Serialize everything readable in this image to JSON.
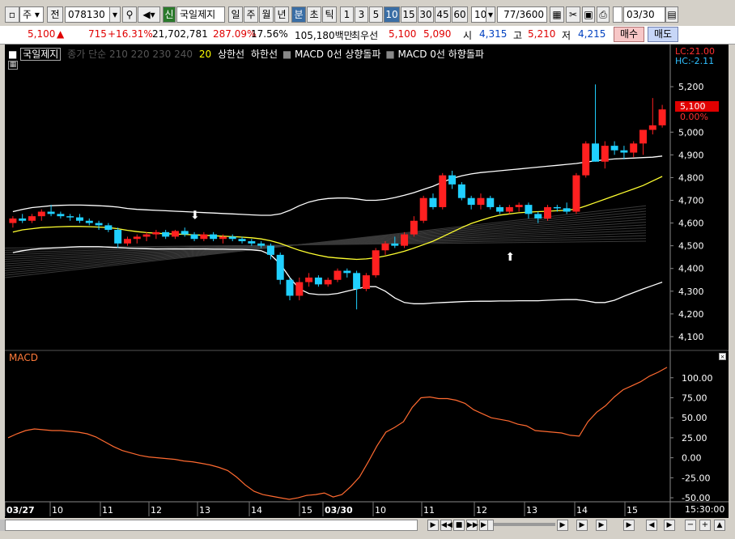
{
  "toolbar": {
    "period": "주",
    "all": "전",
    "code": "078130",
    "credit": "신",
    "stock_name": "국일제지",
    "periods": [
      "일",
      "주",
      "월",
      "년",
      "분",
      "초",
      "틱"
    ],
    "intervals": [
      "1",
      "3",
      "5",
      "10",
      "15",
      "30",
      "45",
      "60"
    ],
    "count": "10",
    "pages": "77",
    "pages_total": "/3600",
    "date": "03/30"
  },
  "info": {
    "price": "5,100",
    "arrow": "▲",
    "change": "715",
    "change_pct": "+16.31%",
    "volume": "21,702,781",
    "vol_pct": "287.09%",
    "turnover": "17.56%",
    "amount": "105,180백만",
    "bid_label": "최우선",
    "bid1": "5,100",
    "bid2": "5,090",
    "open_label": "시",
    "open": "4,315",
    "high_label": "고",
    "high": "5,210",
    "low_label": "저",
    "low": "4,215",
    "buy": "매수",
    "sell": "매도"
  },
  "legend": {
    "name": "국일제지",
    "ma": "종가 단순 210  220  230  240",
    "ma20": "20",
    "upper": "상한선",
    "lower": "하한선",
    "macd_up": "MACD 0선 상향돌파",
    "macd_down": "MACD 0선 하향돌파",
    "lc": "LC:21.00",
    "hc": "HC:-2.11"
  },
  "macd_label": "MACD",
  "price_box": "5,100",
  "price_pct": "0.00%",
  "time_label": "15:30:00",
  "chart_data": {
    "type": "candlestick",
    "price_axis": {
      "ticks": [
        "5,200",
        "5,000",
        "4,900",
        "4,800",
        "4,700",
        "4,600",
        "4,500",
        "4,400",
        "4,300",
        "4,200",
        "4,100"
      ],
      "ylim": [
        4050,
        5350
      ]
    },
    "macd_axis": {
      "ticks": [
        "100.00",
        "75.00",
        "50.00",
        "25.00",
        "0.00",
        "-25.00",
        "-50.00"
      ],
      "ylim": [
        -55,
        120
      ]
    },
    "x_ticks": [
      "03/27",
      "10",
      "11",
      "12",
      "13",
      "14",
      "15",
      "03/30",
      "10",
      "11",
      "12",
      "13",
      "14",
      "15"
    ],
    "candles": [
      [
        4600,
        4630,
        4580,
        4620
      ],
      [
        4620,
        4640,
        4600,
        4610
      ],
      [
        4610,
        4640,
        4600,
        4630
      ],
      [
        4630,
        4660,
        4610,
        4650
      ],
      [
        4650,
        4680,
        4630,
        4640
      ],
      [
        4640,
        4650,
        4620,
        4630
      ],
      [
        4630,
        4640,
        4610,
        4625
      ],
      [
        4625,
        4640,
        4600,
        4610
      ],
      [
        4610,
        4620,
        4590,
        4600
      ],
      [
        4600,
        4610,
        4570,
        4590
      ],
      [
        4590,
        4600,
        4560,
        4570
      ],
      [
        4570,
        4580,
        4490,
        4510
      ],
      [
        4510,
        4540,
        4500,
        4530
      ],
      [
        4530,
        4550,
        4510,
        4540
      ],
      [
        4540,
        4560,
        4520,
        4550
      ],
      [
        4550,
        4570,
        4530,
        4560
      ],
      [
        4560,
        4570,
        4530,
        4540
      ],
      [
        4540,
        4570,
        4530,
        4565
      ],
      [
        4565,
        4580,
        4540,
        4550
      ],
      [
        4550,
        4560,
        4520,
        4530
      ],
      [
        4530,
        4560,
        4520,
        4550
      ],
      [
        4550,
        4560,
        4520,
        4530
      ],
      [
        4530,
        4550,
        4510,
        4540
      ],
      [
        4540,
        4550,
        4520,
        4530
      ],
      [
        4530,
        4540,
        4510,
        4520
      ],
      [
        4520,
        4530,
        4500,
        4510
      ],
      [
        4510,
        4520,
        4490,
        4500
      ],
      [
        4500,
        4510,
        4440,
        4460
      ],
      [
        4460,
        4470,
        4330,
        4350
      ],
      [
        4350,
        4360,
        4260,
        4280
      ],
      [
        4280,
        4360,
        4260,
        4340
      ],
      [
        4340,
        4380,
        4320,
        4360
      ],
      [
        4360,
        4370,
        4320,
        4330
      ],
      [
        4330,
        4360,
        4320,
        4350
      ],
      [
        4350,
        4400,
        4340,
        4390
      ],
      [
        4390,
        4400,
        4360,
        4380
      ],
      [
        4380,
        4390,
        4220,
        4310
      ],
      [
        4310,
        4380,
        4300,
        4370
      ],
      [
        4370,
        4490,
        4360,
        4480
      ],
      [
        4480,
        4520,
        4460,
        4510
      ],
      [
        4510,
        4540,
        4490,
        4500
      ],
      [
        4500,
        4560,
        4490,
        4550
      ],
      [
        4550,
        4630,
        4540,
        4610
      ],
      [
        4610,
        4720,
        4600,
        4710
      ],
      [
        4710,
        4730,
        4660,
        4670
      ],
      [
        4670,
        4820,
        4660,
        4810
      ],
      [
        4810,
        4830,
        4750,
        4770
      ],
      [
        4770,
        4780,
        4700,
        4710
      ],
      [
        4710,
        4720,
        4660,
        4680
      ],
      [
        4680,
        4730,
        4660,
        4710
      ],
      [
        4710,
        4720,
        4660,
        4670
      ],
      [
        4670,
        4680,
        4640,
        4650
      ],
      [
        4650,
        4680,
        4640,
        4670
      ],
      [
        4670,
        4690,
        4650,
        4680
      ],
      [
        4680,
        4690,
        4620,
        4640
      ],
      [
        4640,
        4650,
        4600,
        4620
      ],
      [
        4620,
        4680,
        4610,
        4670
      ],
      [
        4670,
        4680,
        4650,
        4665
      ],
      [
        4665,
        4690,
        4640,
        4650
      ],
      [
        4650,
        4820,
        4640,
        4810
      ],
      [
        4810,
        4960,
        4800,
        4950
      ],
      [
        4950,
        5210,
        4870,
        4870
      ],
      [
        4870,
        4960,
        4840,
        4940
      ],
      [
        4940,
        4960,
        4900,
        4920
      ],
      [
        4920,
        4940,
        4880,
        4910
      ],
      [
        4910,
        4960,
        4890,
        4950
      ],
      [
        4950,
        5000,
        4900,
        5010
      ],
      [
        5010,
        5150,
        4990,
        5030
      ],
      [
        5030,
        5120,
        5020,
        5100
      ]
    ],
    "ma20": [
      4560,
      4570,
      4575,
      4580,
      4582,
      4584,
      4585,
      4585,
      4584,
      4582,
      4580,
      4575,
      4568,
      4562,
      4558,
      4555,
      4553,
      4552,
      4550,
      4548,
      4546,
      4544,
      4542,
      4540,
      4538,
      4535,
      4530,
      4522,
      4510,
      4495,
      4480,
      4468,
      4458,
      4450,
      4446,
      4443,
      4440,
      4442,
      4447,
      4455,
      4465,
      4476,
      4490,
      4505,
      4520,
      4540,
      4560,
      4580,
      4598,
      4612,
      4625,
      4635,
      4640,
      4645,
      4648,
      4650,
      4652,
      4654,
      4656,
      4662,
      4675,
      4690,
      4705,
      4720,
      4735,
      4750,
      4765,
      4785,
      4805
    ],
    "upper": [
      4650,
      4660,
      4668,
      4672,
      4676,
      4678,
      4679,
      4679,
      4678,
      4676,
      4674,
      4670,
      4664,
      4660,
      4658,
      4656,
      4654,
      4652,
      4650,
      4648,
      4646,
      4644,
      4642,
      4640,
      4638,
      4636,
      4634,
      4634,
      4640,
      4656,
      4676,
      4692,
      4702,
      4708,
      4710,
      4710,
      4706,
      4700,
      4700,
      4704,
      4712,
      4722,
      4734,
      4748,
      4762,
      4780,
      4796,
      4808,
      4816,
      4822,
      4826,
      4830,
      4834,
      4838,
      4842,
      4846,
      4850,
      4854,
      4858,
      4862,
      4868,
      4874,
      4878,
      4882,
      4884,
      4886,
      4888,
      4890,
      4895
    ],
    "lower": [
      4470,
      4478,
      4484,
      4488,
      4490,
      4492,
      4494,
      4496,
      4496,
      4496,
      4494,
      4492,
      4490,
      4488,
      4487,
      4486,
      4486,
      4486,
      4486,
      4486,
      4486,
      4485,
      4485,
      4484,
      4484,
      4482,
      4478,
      4460,
      4420,
      4360,
      4310,
      4290,
      4285,
      4285,
      4290,
      4300,
      4310,
      4320,
      4320,
      4300,
      4270,
      4250,
      4245,
      4245,
      4248,
      4250,
      4252,
      4254,
      4255,
      4256,
      4256,
      4257,
      4257,
      4258,
      4258,
      4258,
      4260,
      4262,
      4263,
      4263,
      4258,
      4250,
      4250,
      4260,
      4278,
      4294,
      4310,
      4325,
      4340
    ],
    "macd": [
      25,
      30,
      34,
      36,
      35,
      34,
      34,
      33,
      32,
      30,
      26,
      20,
      14,
      9,
      6,
      3,
      1,
      0,
      -1,
      -2,
      -4,
      -5,
      -7,
      -9,
      -12,
      -16,
      -24,
      -34,
      -42,
      -46,
      -48,
      -50,
      -52,
      -50,
      -47,
      -46,
      -44,
      -49,
      -46,
      -36,
      -24,
      -5,
      15,
      32,
      38,
      45,
      63,
      75,
      76,
      74,
      74,
      72,
      68,
      60,
      55,
      50,
      48,
      46,
      42,
      40,
      34,
      33,
      32,
      31,
      28,
      27,
      45,
      57,
      65,
      76,
      85,
      90,
      95,
      102,
      107,
      113
    ]
  }
}
